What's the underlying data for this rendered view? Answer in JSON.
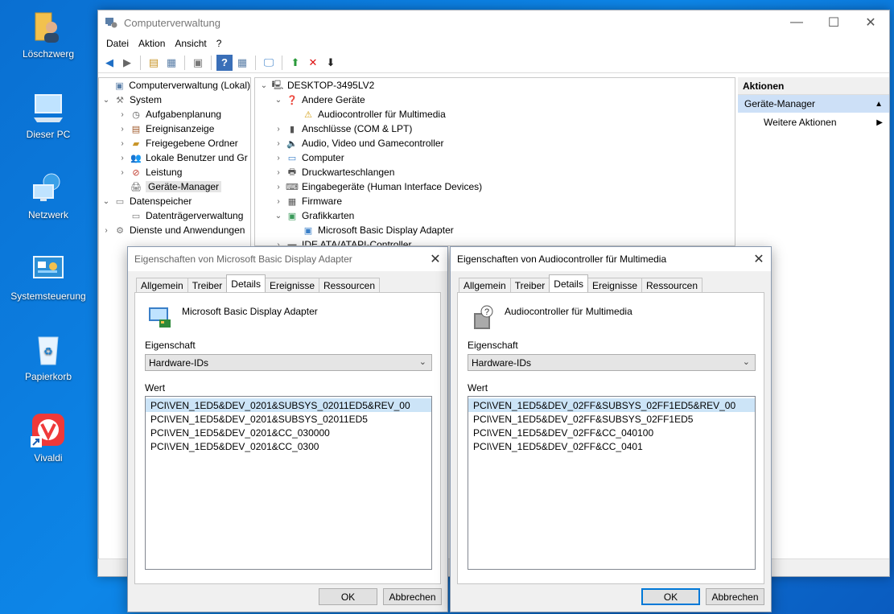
{
  "desktop": {
    "icons": [
      {
        "label": "Löschzwerg"
      },
      {
        "label": "Dieser PC"
      },
      {
        "label": "Netzwerk"
      },
      {
        "label": "Systemsteuerung"
      },
      {
        "label": "Papierkorb"
      },
      {
        "label": "Vivaldi"
      }
    ]
  },
  "mmc": {
    "title": "Computerverwaltung",
    "menu": [
      "Datei",
      "Aktion",
      "Ansicht",
      "?"
    ],
    "tree": [
      {
        "label": "Computerverwaltung (Lokal)",
        "icon": "computer-management-icon"
      },
      {
        "label": "System",
        "icon": "tools-icon"
      },
      {
        "label": "Aufgabenplanung",
        "icon": "clock-icon"
      },
      {
        "label": "Ereignisanzeige",
        "icon": "event-viewer-icon"
      },
      {
        "label": "Freigegebene Ordner",
        "icon": "shared-folder-icon"
      },
      {
        "label": "Lokale Benutzer und Gr",
        "icon": "users-icon"
      },
      {
        "label": "Leistung",
        "icon": "performance-icon"
      },
      {
        "label": "Geräte-Manager",
        "icon": "device-manager-icon"
      },
      {
        "label": "Datenspeicher",
        "icon": "storage-icon"
      },
      {
        "label": "Datenträgerverwaltung",
        "icon": "disk-icon"
      },
      {
        "label": "Dienste und Anwendungen",
        "icon": "services-icon"
      }
    ],
    "devices": [
      {
        "label": "DESKTOP-3495LV2"
      },
      {
        "label": "Andere Geräte"
      },
      {
        "label": "Audiocontroller für Multimedia"
      },
      {
        "label": "Anschlüsse (COM & LPT)"
      },
      {
        "label": "Audio, Video und Gamecontroller"
      },
      {
        "label": "Computer"
      },
      {
        "label": "Druckwarteschlangen"
      },
      {
        "label": "Eingabegeräte (Human Interface Devices)"
      },
      {
        "label": "Firmware"
      },
      {
        "label": "Grafikkarten"
      },
      {
        "label": "Microsoft Basic Display Adapter"
      },
      {
        "label": "IDE ATA/ATAPI-Controller"
      }
    ],
    "actions": {
      "header": "Aktionen",
      "section": "Geräte-Manager",
      "item": "Weitere Aktionen"
    }
  },
  "dialog_display": {
    "title": "Eigenschaften von Microsoft Basic Display Adapter",
    "tabs": [
      "Allgemein",
      "Treiber",
      "Details",
      "Ereignisse",
      "Ressourcen"
    ],
    "active_tab": "Details",
    "device_name": "Microsoft Basic Display Adapter",
    "property_label": "Eigenschaft",
    "property_value": "Hardware-IDs",
    "value_label": "Wert",
    "values": [
      "PCI\\VEN_1ED5&DEV_0201&SUBSYS_02011ED5&REV_00",
      "PCI\\VEN_1ED5&DEV_0201&SUBSYS_02011ED5",
      "PCI\\VEN_1ED5&DEV_0201&CC_030000",
      "PCI\\VEN_1ED5&DEV_0201&CC_0300"
    ],
    "ok": "OK",
    "cancel": "Abbrechen"
  },
  "dialog_audio": {
    "title": "Eigenschaften von Audiocontroller für Multimedia",
    "tabs": [
      "Allgemein",
      "Treiber",
      "Details",
      "Ereignisse",
      "Ressourcen"
    ],
    "active_tab": "Details",
    "device_name": "Audiocontroller für Multimedia",
    "property_label": "Eigenschaft",
    "property_value": "Hardware-IDs",
    "value_label": "Wert",
    "values": [
      "PCI\\VEN_1ED5&DEV_02FF&SUBSYS_02FF1ED5&REV_00",
      "PCI\\VEN_1ED5&DEV_02FF&SUBSYS_02FF1ED5",
      "PCI\\VEN_1ED5&DEV_02FF&CC_040100",
      "PCI\\VEN_1ED5&DEV_02FF&CC_0401"
    ],
    "ok": "OK",
    "cancel": "Abbrechen"
  },
  "colors": {
    "accent": "#0078d7",
    "selection": "#cce4f7",
    "desktop": "#0d86e8"
  }
}
